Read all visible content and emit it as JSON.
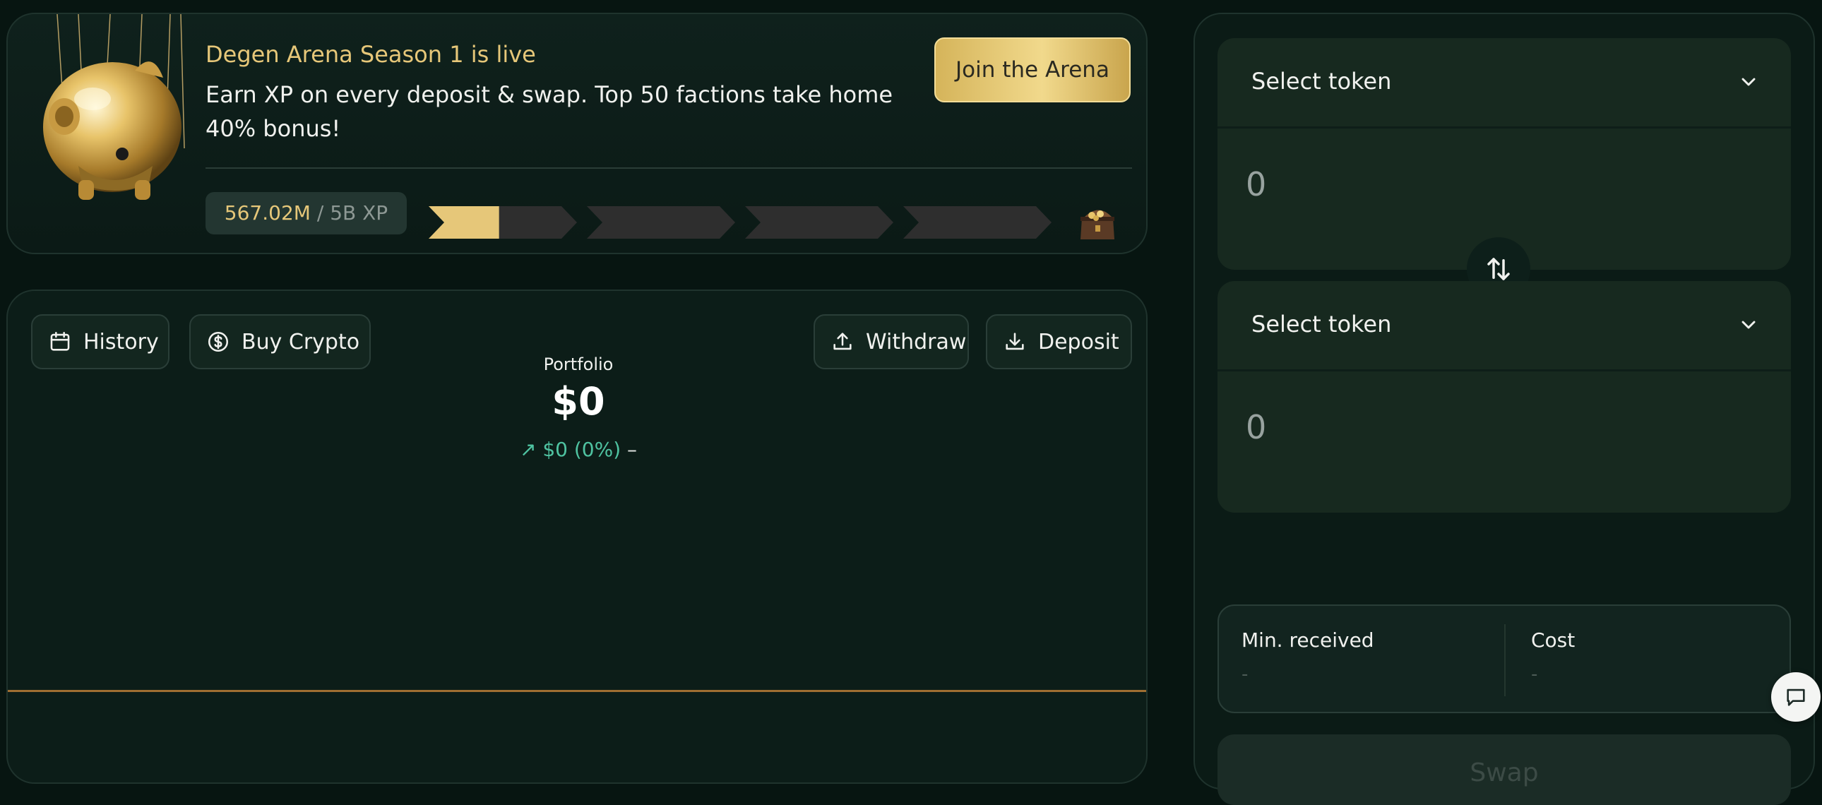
{
  "banner": {
    "title": "Degen Arena Season 1 is live",
    "description": "Earn XP on every deposit & swap. Top 50 factions take home 40% bonus!",
    "cta_label": "Join the Arena",
    "xp_current": "567.02M",
    "xp_separator": "/",
    "xp_total": "5B XP",
    "progress_fraction": 0.113,
    "progress_segments": 4,
    "icons": {
      "mascot": "golden-piggy-bank-icon",
      "reward": "treasure-chest-icon"
    },
    "colors": {
      "accent_gold": "#e6c779",
      "track": "#2e2e2e"
    }
  },
  "portfolio": {
    "actions": {
      "history_label": "History",
      "buy_label": "Buy Crypto",
      "withdraw_label": "Withdraw",
      "deposit_label": "Deposit"
    },
    "label": "Portfolio",
    "value": "$0",
    "change_arrow": "↗",
    "change": "$0 (0%)",
    "period": "–",
    "colors": {
      "positive": "#4fc3a1",
      "chart_line": "#9f6e32"
    }
  },
  "swap": {
    "from": {
      "select_label": "Select token",
      "amount": "0"
    },
    "to": {
      "select_label": "Select token",
      "amount": "0"
    },
    "info": {
      "min_received_label": "Min. received",
      "min_received_value": "-",
      "cost_label": "Cost",
      "cost_value": "-"
    },
    "button_label": "Swap"
  }
}
